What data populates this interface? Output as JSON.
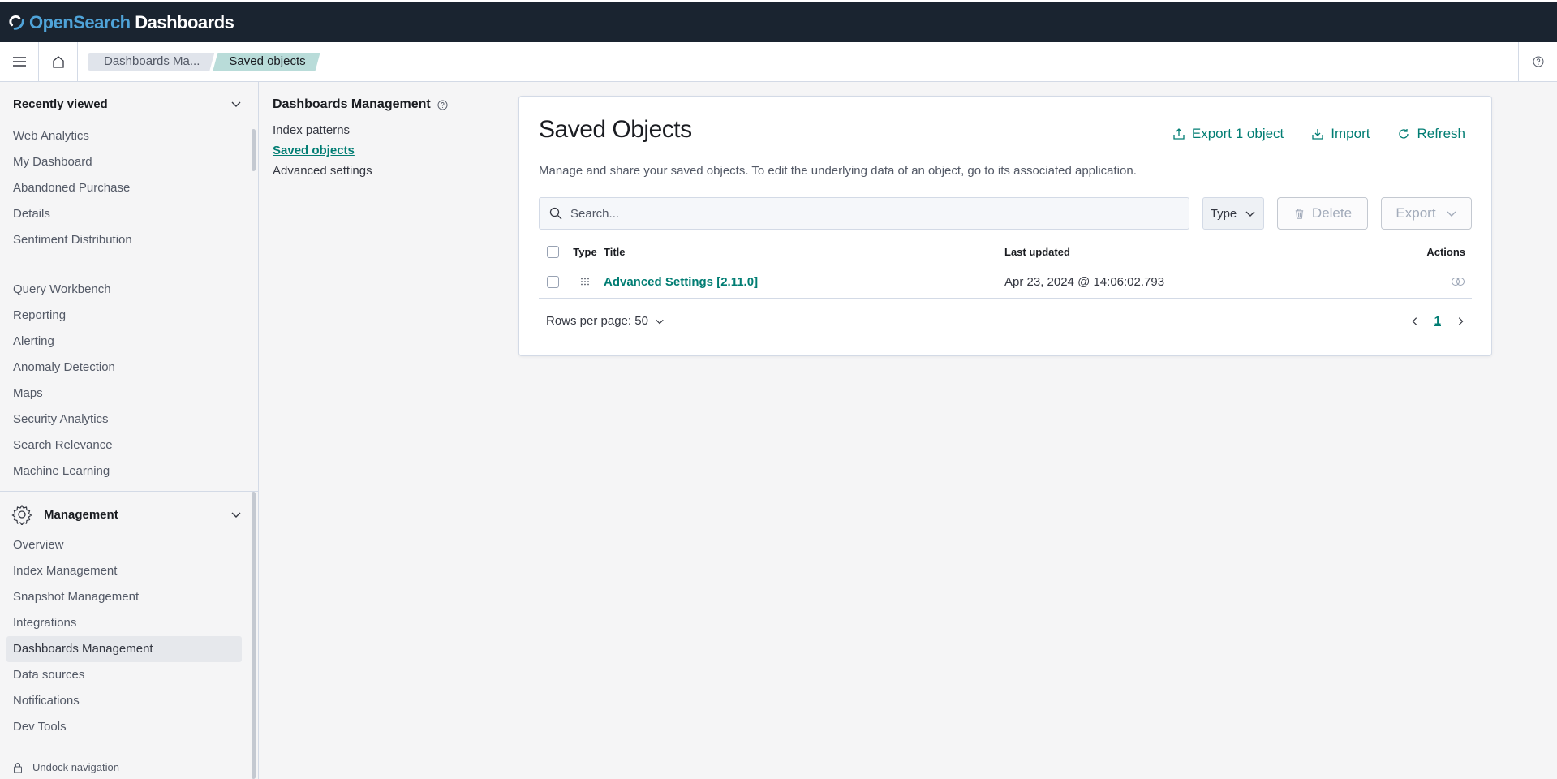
{
  "app": {
    "logo_part1": "Open",
    "logo_part2": "Search",
    "logo_part3": " Dashboards"
  },
  "breadcrumbs": [
    "Dashboards Ma...",
    "Saved objects"
  ],
  "leftnav": {
    "recent_title": "Recently viewed",
    "recent_items": [
      "Web Analytics",
      "My Dashboard",
      "Abandoned Purchase",
      "Details",
      "Sentiment Distribution"
    ],
    "plugin_items": [
      "Query Workbench",
      "Reporting",
      "Alerting",
      "Anomaly Detection",
      "Maps",
      "Security Analytics",
      "Search Relevance",
      "Machine Learning"
    ],
    "management_title": "Management",
    "management_items": [
      "Overview",
      "Index Management",
      "Snapshot Management",
      "Integrations",
      "Dashboards Management",
      "Data sources",
      "Notifications",
      "Dev Tools"
    ],
    "active_item": "Dashboards Management",
    "undock_label": "Undock navigation"
  },
  "mgmt_menu": {
    "title": "Dashboards Management",
    "items": [
      "Index patterns",
      "Saved objects",
      "Advanced settings"
    ],
    "selected": "Saved objects"
  },
  "main": {
    "title": "Saved Objects",
    "actions": {
      "export": "Export 1 object",
      "import": "Import",
      "refresh": "Refresh"
    },
    "description": "Manage and share your saved objects. To edit the underlying data of an object, go to its associated application.",
    "search_placeholder": "Search...",
    "type_filter": "Type",
    "delete_label": "Delete",
    "export_label": "Export",
    "table": {
      "columns": [
        "Type",
        "Title",
        "Last updated",
        "Actions"
      ],
      "rows": [
        {
          "title": "Advanced Settings [2.11.0]",
          "last_updated": "Apr 23, 2024 @ 14:06:02.793"
        }
      ]
    },
    "rows_per_page": "Rows per page: 50",
    "current_page": "1"
  },
  "colors": {
    "accent": "#017d73",
    "topbar": "#1a2430",
    "breadcrumb_active": "#b9dcd9"
  }
}
